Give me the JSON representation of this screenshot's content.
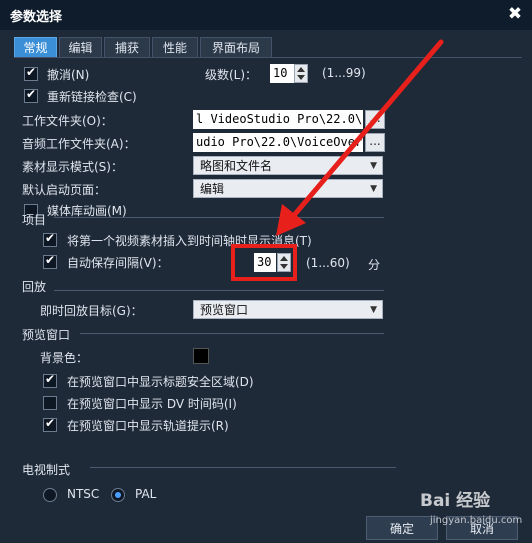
{
  "window": {
    "title": "参数选择",
    "close_symbol": "✖"
  },
  "tabs": [
    {
      "label": "常规",
      "active": true
    },
    {
      "label": "编辑"
    },
    {
      "label": "捕获"
    },
    {
      "label": "性能"
    },
    {
      "label": "界面布局"
    }
  ],
  "general": {
    "undo": {
      "label": "撤消(N)",
      "checked": true,
      "levels_label": "级数(L)：",
      "levels_value": "10",
      "levels_range": "(1...99)"
    },
    "relink": {
      "label": "重新链接检查(C)",
      "checked": true
    },
    "work_folder": {
      "label": "工作文件夹(O)：",
      "value": "l VideoStudio Pro\\22.0\\",
      "browse": "..."
    },
    "audio_work_folder": {
      "label": "音频工作文件夹(A)：",
      "value": "udio Pro\\22.0\\VoiceOver\\",
      "browse": "..."
    },
    "clip_display_mode": {
      "label": "素材显示模式(S)：",
      "value": "略图和文件名"
    },
    "default_startup_page": {
      "label": "默认启动页面：",
      "value": "编辑"
    },
    "library_animation": {
      "label": "媒体库动画(M)",
      "checked": false
    }
  },
  "project": {
    "heading": "项目",
    "insert_msg": {
      "label": "将第一个视频素材插入到时间轴时显示消息(T)",
      "checked": true
    },
    "autosave": {
      "label": "自动保存间隔(V)：",
      "checked": true,
      "value": "30",
      "range": "(1...60)",
      "unit": "分"
    }
  },
  "playback": {
    "heading": "回放",
    "target_label": "即时回放目标(G)：",
    "target_value": "预览窗口"
  },
  "preview": {
    "heading": "预览窗口",
    "bg_label": "背景色：",
    "bg_color": "#000000",
    "title_safe": {
      "label": "在预览窗口中显示标题安全区域(D)",
      "checked": true
    },
    "dv_timecode": {
      "label": "在预览窗口中显示 DV 时间码(I)",
      "checked": false
    },
    "track_hints": {
      "label": "在预览窗口中显示轨道提示(R)",
      "checked": true
    }
  },
  "tv_system": {
    "heading": "电视制式",
    "options": [
      {
        "label": "NTSC",
        "selected": false
      },
      {
        "label": "PAL",
        "selected": true
      }
    ]
  },
  "buttons": {
    "ok": "确定",
    "cancel": "取消"
  },
  "watermark": {
    "text": "Bai 经验",
    "url": "jingyan.baidu.com"
  },
  "annotation": {
    "color": "#e8201c"
  }
}
